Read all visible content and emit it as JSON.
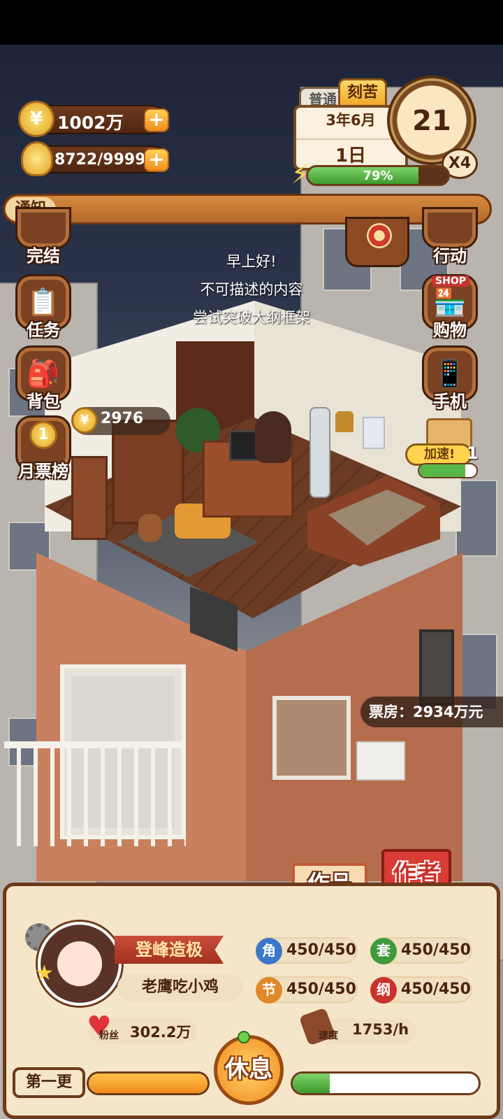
{
  "currency": {
    "coins": "1002万",
    "energy": "8722/9999",
    "coin_glyph": "¥",
    "plus": "+"
  },
  "calendar": {
    "mode_normal": "普通",
    "mode_hard": "刻苦",
    "month": "3年6月",
    "day": "1日",
    "count": "21",
    "multiplier": "X4",
    "progress_label": "79%",
    "progress": 0.79
  },
  "notice": {
    "label": "通知",
    "text": ""
  },
  "left_menu": [
    {
      "label": "完结",
      "icon": "book-icon"
    },
    {
      "label": "任务",
      "icon": "clipboard-icon"
    },
    {
      "label": "背包",
      "icon": "backpack-icon"
    },
    {
      "label": "月票榜",
      "icon": "ranking-coin-icon",
      "glyph": "1"
    }
  ],
  "right_menu": [
    {
      "label": "行动",
      "icon": "door-arrow-icon"
    },
    {
      "label": "购物",
      "icon": "shop-icon",
      "sign": "SHOP"
    },
    {
      "label": "手机",
      "icon": "phone-icon"
    }
  ],
  "speech": [
    "早上好!",
    "不可描述的内容",
    "尝试突破大纲框架"
  ],
  "scene": {
    "coin_bubble": "2976",
    "boost_label": "加速!",
    "boost_count": "1",
    "boost_progress": 0.8,
    "box_office": "票房：2934万元"
  },
  "tabs": {
    "works": "作品",
    "author": "作者"
  },
  "profile": {
    "title": "登峰造极",
    "name": "老鹰吃小鸡",
    "fans_label": "粉丝",
    "fans": "302.2万",
    "speed_label": "速度",
    "speed": "1753/h"
  },
  "stats": [
    {
      "icon_char": "角",
      "value": "450/450",
      "color": "#3b78c9"
    },
    {
      "icon_char": "套",
      "value": "450/450",
      "color": "#3f9a3a"
    },
    {
      "icon_char": "节",
      "value": "450/450",
      "color": "#e0892a"
    },
    {
      "icon_char": "纲",
      "value": "450/450",
      "color": "#c9332d"
    }
  ],
  "bottom": {
    "chapter_label": "第一更",
    "rest_button": "休息",
    "chapter_progress": 1.0,
    "rest_progress": 0.2
  }
}
